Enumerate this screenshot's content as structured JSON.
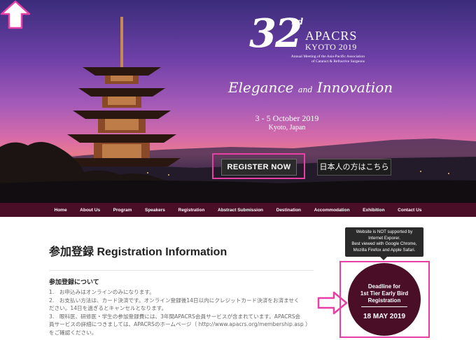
{
  "logo": {
    "number": "32",
    "superscript": "nd",
    "name": "APACRS",
    "city_year": "KYOTO 2019",
    "subtitle_line1": "Annual Meeting of the Asia-Pacific Association",
    "subtitle_line2": "of Cataract & Refractive Surgeons"
  },
  "tagline": {
    "left": "Elegance",
    "and": "and",
    "right": "Innovation"
  },
  "event": {
    "dates": "3 - 5 October 2019",
    "location": "Kyoto, Japan"
  },
  "buttons": {
    "register": "REGISTER NOW",
    "japanese": "日本人の方はこちら"
  },
  "nav": {
    "items": [
      "Home",
      "About Us",
      "Program",
      "Speakers",
      "Registration",
      "Abstract Submission",
      "Destination",
      "Accommodation",
      "Exhibition",
      "Contact Us"
    ]
  },
  "page": {
    "title": "参加登録 Registration Information",
    "section_heading": "参加登録について",
    "lines": [
      "1.　お申込みはオンラインのみになります。",
      "2.　お支払い方法は、カード決済です。オンライン登録後14日以内にクレジットカード決済をお済ませく",
      "ださい。14日を過ぎるとキャンセルとなります。",
      "3.　眼科医、研修医・学生の参加登録費には、3年間APACRS会員サービスが含まれています。APACRS会",
      "員サービスの詳細につきましては、APACRSのホームページ（ http://www.apacrs.org/membership.asp ）",
      "をご確認ください。"
    ]
  },
  "notice": {
    "lines": [
      "Website is NOT supported by",
      "Internet Exporer.",
      "Best viewed with Google Chrome,",
      "Mozilla Firefox and Apple Safari."
    ]
  },
  "badge": {
    "line1": "Deadline for",
    "line2": "1st Tier Early Bird",
    "line3": "Registration",
    "date": "18 MAY 2019"
  },
  "colors": {
    "nav_bg": "#4b0e27",
    "highlight": "#e83fa6",
    "badge_bg": "#4b0e27",
    "button_bg": "#2b2b2b"
  }
}
